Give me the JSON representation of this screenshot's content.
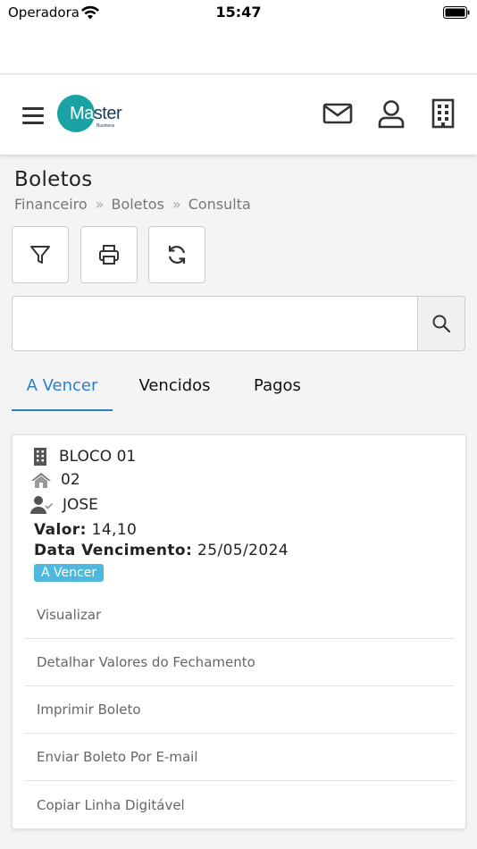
{
  "status_bar": {
    "carrier": "Operadora",
    "time": "15:47"
  },
  "logo": {
    "text_m": "M",
    "text_rest": "ster",
    "text_o": "a",
    "sub": "Business"
  },
  "page": {
    "title": "Boletos"
  },
  "breadcrumb": [
    "Financeiro",
    "Boletos",
    "Consulta"
  ],
  "search": {
    "placeholder": ""
  },
  "tabs": [
    {
      "label": "A Vencer",
      "active": true
    },
    {
      "label": "Vencidos",
      "active": false
    },
    {
      "label": "Pagos",
      "active": false
    }
  ],
  "card": {
    "bloco": "BLOCO 01",
    "unidade": "02",
    "nome": "JOSE",
    "valor_label": "Valor:",
    "valor": "14,10",
    "vencimento_label": "Data Vencimento:",
    "vencimento": "25/05/2024",
    "status": "A Vencer",
    "actions": [
      "Visualizar",
      "Detalhar Valores do Fechamento",
      "Imprimir Boleto",
      "Enviar Boleto Por E-mail",
      "Copiar Linha Digitável"
    ]
  },
  "colors": {
    "accent": "#2d7ec4",
    "badge": "#4eb8de",
    "logo": "#19a3a5"
  },
  "icons": [
    "wifi-icon",
    "battery-icon",
    "menu-icon",
    "mail-icon",
    "user-icon",
    "building-icon",
    "filter-icon",
    "printer-icon",
    "refresh-icon",
    "search-icon",
    "home-icon",
    "user-check-icon"
  ]
}
